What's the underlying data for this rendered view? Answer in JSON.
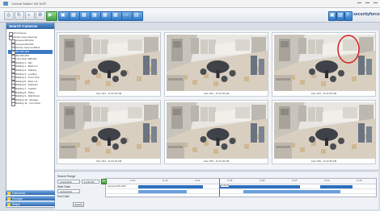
{
  "window": {
    "title": "Central Station HD NVR"
  },
  "toolbar": {
    "left_buttons": [
      {
        "name": "camera-add-icon",
        "glyph": "◎",
        "style": "plain"
      },
      {
        "name": "refresh-icon",
        "glyph": "↻",
        "style": "plain"
      },
      {
        "name": "search-icon",
        "glyph": "⌕",
        "style": "plain"
      },
      {
        "name": "settings-icon",
        "glyph": "⚙",
        "style": "plain"
      },
      {
        "name": "play-icon",
        "glyph": "▶",
        "style": "green"
      },
      {
        "name": "layout-1x1-icon",
        "glyph": "▣",
        "style": "blue"
      },
      {
        "name": "layout-2x2-icon",
        "glyph": "▦",
        "style": "blue"
      },
      {
        "name": "layout-3x2-icon",
        "glyph": "▦",
        "style": "blue"
      },
      {
        "name": "layout-3x3-icon",
        "glyph": "▦",
        "style": "blue"
      },
      {
        "name": "layout-4x4-icon",
        "glyph": "▦",
        "style": "blue"
      },
      {
        "name": "layout-5x5-icon",
        "glyph": "▦",
        "style": "blue"
      },
      {
        "name": "fullscreen-icon",
        "glyph": "▭",
        "style": "blue"
      },
      {
        "name": "sequence-icon",
        "glyph": "▤",
        "style": "blue"
      }
    ],
    "right_buttons": [
      {
        "name": "export-icon",
        "glyph": "▣"
      },
      {
        "name": "print-icon",
        "glyph": "▤"
      },
      {
        "name": "help-icon",
        "glyph": "?"
      }
    ],
    "brand": "securityforce"
  },
  "left_panel": {
    "header": "Search Cameras",
    "tree": [
      "All Cameras",
      "Kitchen Area Cameras",
      "Camera 001-002",
      "Camera 003-004",
      "Kitchen Camera 005-8",
      "001-002-003",
      "001-002-004",
      "Front Door 008-004",
      "Building 1 - 001",
      "Building 1 - Back Lot",
      "Building 2 - Parking",
      "Building 3 - Loading",
      "Building 4 - Front Door",
      "Building 5 - Rear Lot",
      "Building 6 - Entrance",
      "Building 7 - Cashier",
      "Building 8 - Office",
      "Building 9 - Mail Room",
      "Building 10 - Storage",
      "Building 11 - Gym Area"
    ],
    "selected_index": 5,
    "nav": [
      "Cameras",
      "Groups",
      "Maps"
    ]
  },
  "cameras": [
    {
      "label": "Cam 001 - 11:32:45 AM",
      "highlight": false
    },
    {
      "label": "Cam 002 - 11:32:45 AM",
      "highlight": false
    },
    {
      "label": "Cam 003 - 11:32:45 AM",
      "highlight": true
    },
    {
      "label": "Cam 004 - 11:32:45 AM",
      "highlight": false
    },
    {
      "label": "Cam 005 - 11:32:45 AM",
      "highlight": false
    },
    {
      "label": "Cam 006 - 11:32:45 AM",
      "highlight": false
    }
  ],
  "playback": {
    "section_label": "Search Range",
    "start_date_label": "Start Date",
    "start_date_value": "11/14/2014",
    "start_time_value": "11:00 AM",
    "end_date_label": "End Date",
    "end_date_value": "11/14/2014",
    "search_button": "Search",
    "timeline_ticks": [
      "11:00",
      "11:15",
      "11:30",
      "11:45",
      "12:00",
      "12:15",
      "12:30",
      "12:45"
    ],
    "cursor_label": "11:32:45",
    "row_label": "Cameras 001-006"
  },
  "colors": {
    "accent": "#2c6fc0",
    "highlight_circle": "#d81f1f"
  }
}
